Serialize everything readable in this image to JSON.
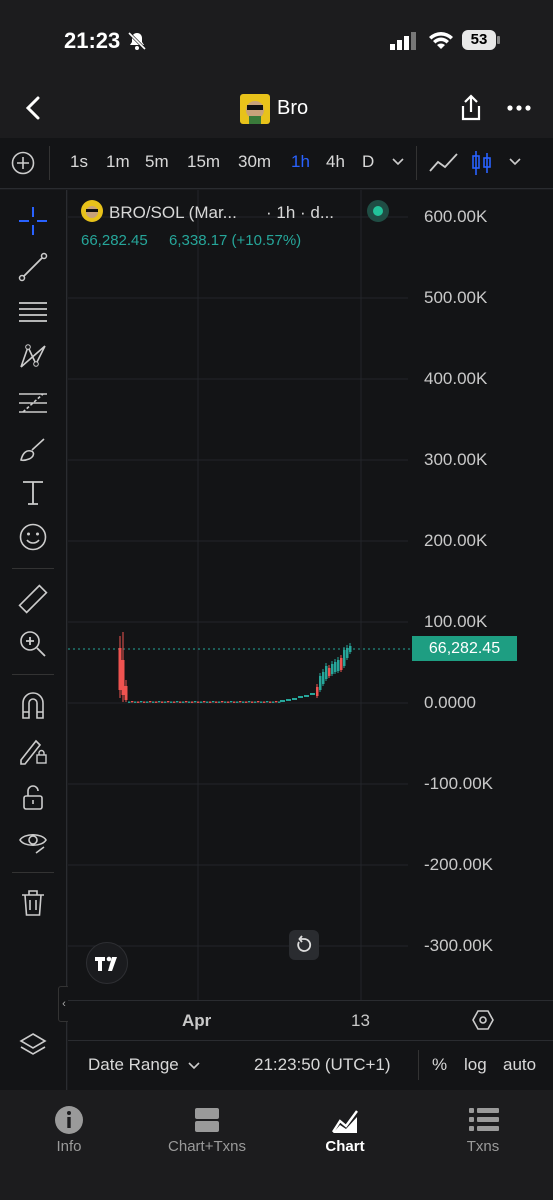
{
  "status_bar": {
    "time": "21:23",
    "battery": "53"
  },
  "header": {
    "title": "Bro"
  },
  "timeframes": [
    "1s",
    "1m",
    "5m",
    "15m",
    "30m",
    "1h",
    "4h",
    "D"
  ],
  "active_timeframe": "1h",
  "legend": {
    "pair": "BRO/SOL (Mar...",
    "interval": "· 1h · d...",
    "price": "66,282.45",
    "change": "6,338.17 (+10.57%)"
  },
  "price_axis": [
    "600.00K",
    "500.00K",
    "400.00K",
    "300.00K",
    "200.00K",
    "100.00K",
    "0.0000",
    "-100.00K",
    "-200.00K",
    "-300.00K"
  ],
  "current_price": "66,282.45",
  "time_axis": {
    "apr": "Apr",
    "day13": "13"
  },
  "bottom": {
    "date_range": "Date Range",
    "clock": "21:23:50 (UTC+1)",
    "percent": "%",
    "log": "log",
    "auto": "auto"
  },
  "tabs": [
    {
      "label": "Info"
    },
    {
      "label": "Chart+Txns"
    },
    {
      "label": "Chart"
    },
    {
      "label": "Txns"
    }
  ],
  "colors": {
    "up": "#26a69a",
    "down": "#ef5350",
    "accent": "#2962ff",
    "bg": "#131416"
  }
}
